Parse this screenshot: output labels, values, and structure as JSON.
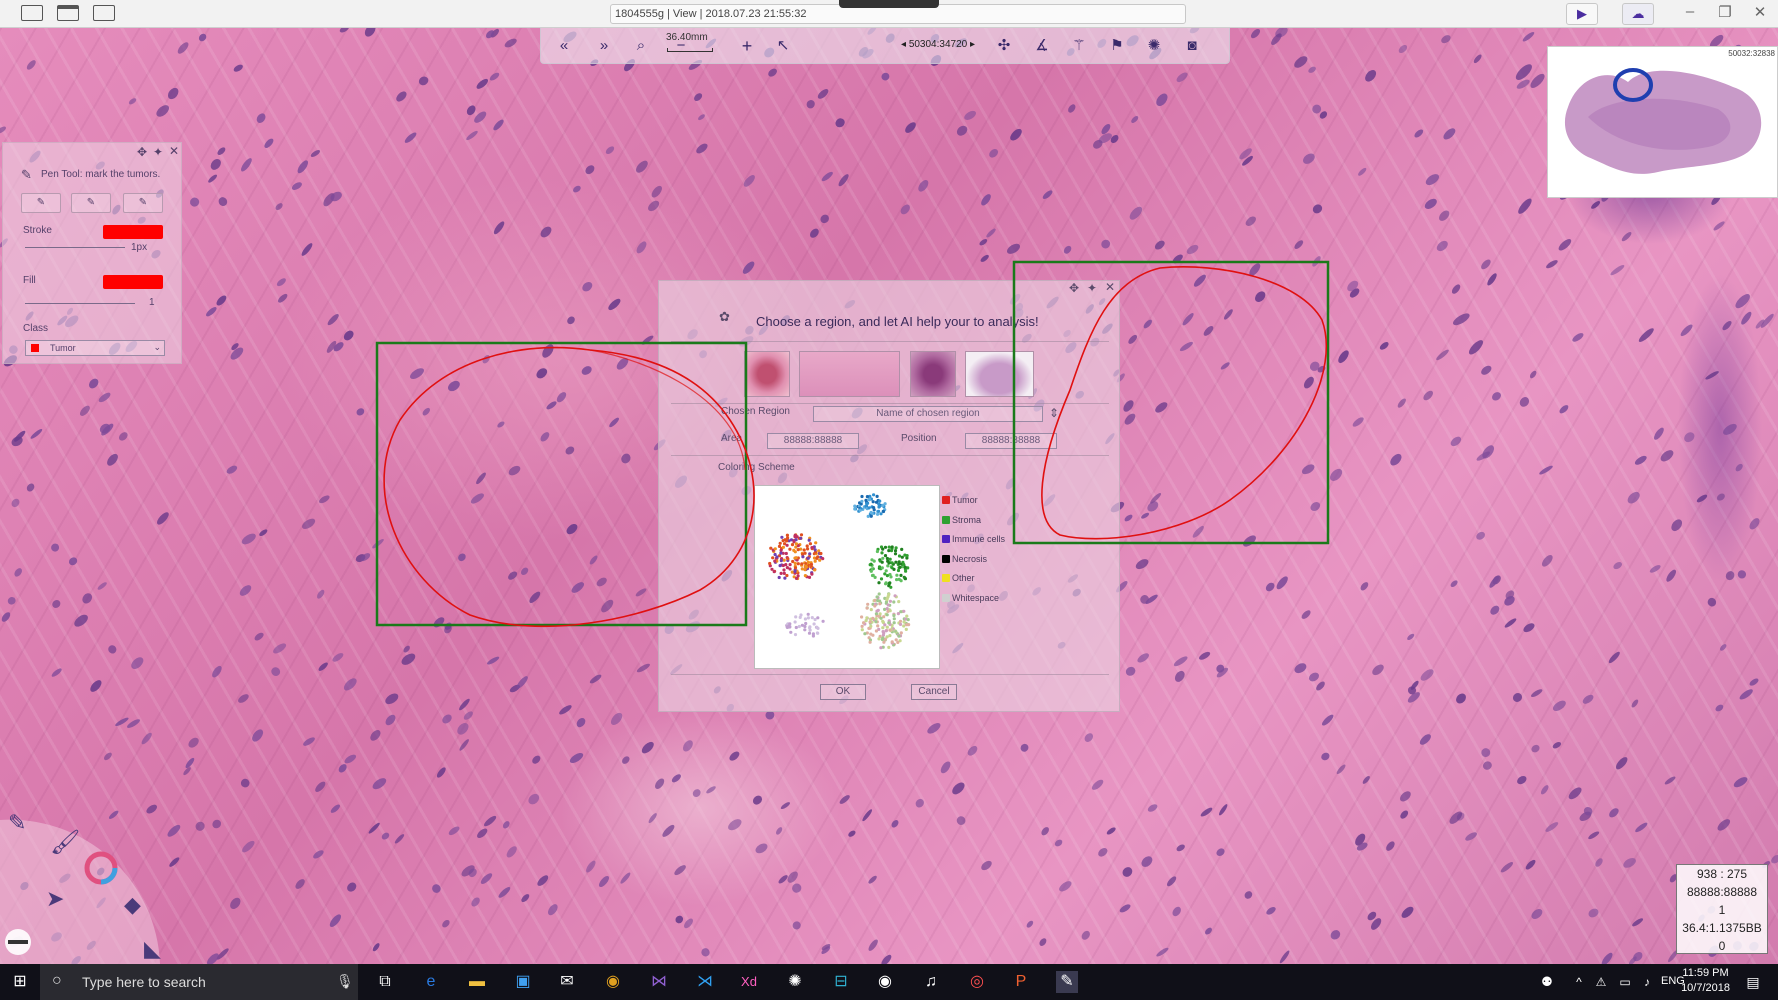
{
  "window": {
    "title": "1804555g | View | 2018.07.23 21:55:32"
  },
  "toolbar": {
    "scale": "36.40mm",
    "coordinates": "50304:34720",
    "tools": [
      "back-icon",
      "forward-icon",
      "zoom-fit-icon",
      "zoom-out-icon",
      "zoom-in-icon",
      "pointer-icon",
      "coordinates-icon",
      "network-icon",
      "ruler-icon",
      "magic-wand-icon",
      "tag-icon",
      "aperture-icon",
      "camera-icon"
    ]
  },
  "minimap": {
    "coordinates": "50032:32838"
  },
  "pen_panel": {
    "hint": "Pen Tool: mark the tumors.",
    "stroke_label": "Stroke",
    "stroke_width": "1px",
    "stroke_color": "#ff0000",
    "fill_label": "Fill",
    "fill_value": "1",
    "fill_color": "#ff0000",
    "class_label": "Class",
    "class_value": "Tumor"
  },
  "dialog": {
    "prompt": "Choose a region, and let AI help your to analysis!",
    "chosen_region_label": "Chosen Region",
    "chosen_region_placeholder": "Name of chosen region",
    "area_label": "Area",
    "area_value": "88888:88888",
    "position_label": "Position",
    "position_value": "88888:88888",
    "coloring_scheme_label": "Coloring Scheme",
    "legend": [
      {
        "label": "Tumor",
        "color": "#e02020"
      },
      {
        "label": "Stroma",
        "color": "#30a030"
      },
      {
        "label": "Immune cells",
        "color": "#5020c0"
      },
      {
        "label": "Necrosis",
        "color": "#000000"
      },
      {
        "label": "Other",
        "color": "#f0e020"
      },
      {
        "label": "Whitespace",
        "color": "#d0d0d0"
      }
    ],
    "ok_label": "OK",
    "cancel_label": "Cancel"
  },
  "info_box": {
    "lines": [
      "938 : 275",
      "88888:88888",
      "1",
      "36.4:1.1375BB",
      "0"
    ]
  },
  "taskbar": {
    "search_placeholder": "Type here to search",
    "language": "ENG",
    "time": "11:59 PM",
    "date": "10/7/2018",
    "notification_count": "0"
  },
  "colors": {
    "annotation_red": "#e01010",
    "selection_green": "#1a7a1a",
    "accent_purple": "#4b2ea0"
  }
}
